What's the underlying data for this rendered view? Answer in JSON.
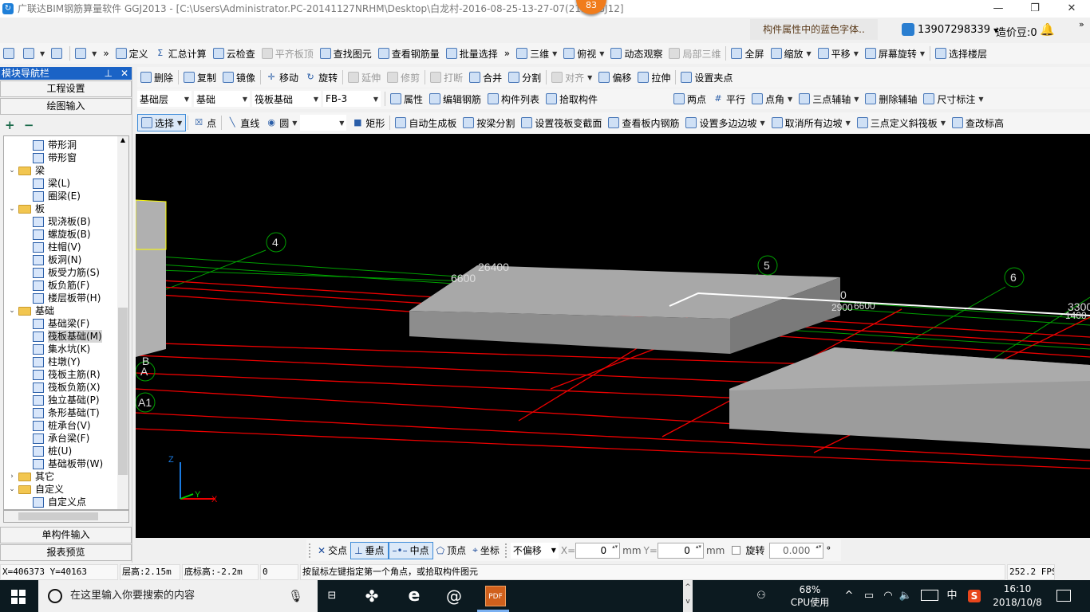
{
  "window": {
    "title": "广联达BIM钢筋算量软件 GGJ2013 - [C:\\Users\\Administrator.PC-20141127NRHM\\Desktop\\白龙村-2016-08-25-13-27-07(21...GGJ12]",
    "app_icon": "glodon-logo",
    "notification_badge": "83",
    "minimize": "—",
    "maximize": "❐",
    "close": "✕"
  },
  "topinfo": {
    "hint": "构件属性中的蓝色字体..",
    "user": "13907298339",
    "beans": "造价豆:0",
    "more": "»"
  },
  "toolbar1": [
    {
      "icon": "new-file-icon",
      "label": ""
    },
    {
      "icon": "open-folder-icon",
      "label": "",
      "dd": true
    },
    {
      "icon": "save-icon",
      "label": ""
    },
    {
      "sep": true
    },
    {
      "icon": "undo-icon",
      "label": "",
      "dd": true
    },
    {
      "icon": "more-icon",
      "label": "»"
    },
    {
      "icon": "define-icon",
      "label": "定义"
    },
    {
      "icon": "sigma-icon",
      "label": "汇总计算",
      "glyph": "Σ"
    },
    {
      "icon": "cloud-check-icon",
      "label": "云检查"
    },
    {
      "icon": "align-top-icon",
      "label": "平齐板顶",
      "disabled": true
    },
    {
      "icon": "binoculars-icon",
      "label": "查找图元"
    },
    {
      "icon": "view-rebar-icon",
      "label": "查看钢筋量"
    },
    {
      "icon": "batch-select-icon",
      "label": "批量选择"
    },
    {
      "icon": "more-icon",
      "label": "»"
    },
    {
      "icon": "cube-3d-icon",
      "label": "三维",
      "dd": true
    },
    {
      "icon": "top-view-icon",
      "label": "俯视",
      "dd": true
    },
    {
      "icon": "orbit-icon",
      "label": "动态观察"
    },
    {
      "icon": "local-3d-icon",
      "label": "局部三维",
      "disabled": true
    },
    {
      "sep": true
    },
    {
      "icon": "fullscreen-icon",
      "label": "全屏"
    },
    {
      "icon": "zoom-icon",
      "label": "缩放",
      "dd": true
    },
    {
      "icon": "pan-hand-icon",
      "label": "平移",
      "dd": true
    },
    {
      "icon": "screen-rotate-icon",
      "label": "屏幕旋转",
      "dd": true
    },
    {
      "sep": true
    },
    {
      "icon": "select-floor-icon",
      "label": "选择楼层"
    }
  ],
  "toolbar2": [
    {
      "icon": "delete-brush-icon",
      "label": "删除"
    },
    {
      "sep": true
    },
    {
      "icon": "copy-icon",
      "label": "复制"
    },
    {
      "icon": "mirror-icon",
      "label": "镜像"
    },
    {
      "sep": true
    },
    {
      "icon": "move-icon",
      "label": "移动",
      "glyph": "✛"
    },
    {
      "icon": "rotate-icon",
      "label": "旋转",
      "glyph": "↻"
    },
    {
      "sep": true
    },
    {
      "icon": "extend-icon",
      "label": "延伸",
      "disabled": true
    },
    {
      "icon": "trim-icon",
      "label": "修剪",
      "disabled": true
    },
    {
      "sep": true
    },
    {
      "icon": "break-icon",
      "label": "打断",
      "disabled": true
    },
    {
      "icon": "merge-icon",
      "label": "合并"
    },
    {
      "icon": "split-icon",
      "label": "分割"
    },
    {
      "sep": true
    },
    {
      "icon": "align-icon",
      "label": "对齐",
      "disabled": true,
      "dd": true
    },
    {
      "icon": "offset-icon",
      "label": "偏移"
    },
    {
      "icon": "stretch-icon",
      "label": "拉伸"
    },
    {
      "sep": true
    },
    {
      "icon": "set-grip-icon",
      "label": "设置夹点"
    }
  ],
  "selectors": {
    "floor": "基础层",
    "category": "基础",
    "type": "筏板基础",
    "member": "FB-3"
  },
  "toolbar3": [
    {
      "icon": "properties-icon",
      "label": "属性"
    },
    {
      "icon": "edit-rebar-icon",
      "label": "编辑钢筋"
    },
    {
      "icon": "member-list-icon",
      "label": "构件列表"
    },
    {
      "icon": "pick-member-icon",
      "label": "拾取构件"
    }
  ],
  "toolbar3b": [
    {
      "icon": "two-point-axis-icon",
      "label": "两点"
    },
    {
      "icon": "parallel-axis-icon",
      "label": "平行",
      "glyph": "#"
    },
    {
      "icon": "point-angle-icon",
      "label": "点角",
      "dd": true
    },
    {
      "icon": "three-point-axis-icon",
      "label": "三点辅轴",
      "dd": true
    },
    {
      "icon": "delete-axis-icon",
      "label": "删除辅轴"
    },
    {
      "icon": "dimension-icon",
      "label": "尺寸标注",
      "dd": true
    }
  ],
  "toolbar4": [
    {
      "icon": "pointer-icon",
      "label": "选择",
      "dd": true,
      "selected": true
    },
    {
      "sep": true
    },
    {
      "icon": "point-icon",
      "label": "点",
      "glyph": "☒"
    },
    {
      "sep": true
    },
    {
      "icon": "line-icon",
      "label": "直线",
      "glyph": "╲"
    },
    {
      "icon": "circle-icon",
      "label": "圆",
      "dd": true,
      "glyph": "◉"
    },
    {
      "combo": true
    },
    {
      "icon": "rectangle-icon",
      "label": "矩形",
      "glyph": "■"
    },
    {
      "sep": true
    },
    {
      "icon": "auto-slab-icon",
      "label": "自动生成板"
    },
    {
      "icon": "split-by-beam-icon",
      "label": "按梁分割"
    },
    {
      "icon": "raft-section-icon",
      "label": "设置筏板变截面"
    },
    {
      "icon": "view-slab-rebar-icon",
      "label": "查看板内钢筋"
    },
    {
      "icon": "multi-slope-icon",
      "label": "设置多边边坡",
      "dd": true
    },
    {
      "icon": "cancel-slope-icon",
      "label": "取消所有边坡",
      "dd": true
    },
    {
      "icon": "three-point-slope-icon",
      "label": "三点定义斜筏板",
      "dd": true
    },
    {
      "icon": "edit-elevation-icon",
      "label": "查改标高"
    }
  ],
  "nav": {
    "title": "模块导航栏",
    "pin": "ꟻ",
    "close": "✕",
    "project_settings": "工程设置",
    "drawing_input": "绘图输入",
    "expand_all": "+",
    "collapse_all": "−",
    "single_input": "单构件输入",
    "report_preview": "报表预览",
    "tree": [
      {
        "level": 2,
        "label": "带形洞"
      },
      {
        "level": 2,
        "label": "带形窗"
      },
      {
        "level": 1,
        "label": "梁",
        "open": true
      },
      {
        "level": 2,
        "label": "梁(L)"
      },
      {
        "level": 2,
        "label": "圈梁(E)"
      },
      {
        "level": 1,
        "label": "板",
        "open": true
      },
      {
        "level": 2,
        "label": "现浇板(B)"
      },
      {
        "level": 2,
        "label": "螺旋板(B)"
      },
      {
        "level": 2,
        "label": "柱帽(V)"
      },
      {
        "level": 2,
        "label": "板洞(N)"
      },
      {
        "level": 2,
        "label": "板受力筋(S)"
      },
      {
        "level": 2,
        "label": "板负筋(F)"
      },
      {
        "level": 2,
        "label": "楼层板带(H)"
      },
      {
        "level": 1,
        "label": "基础",
        "open": true
      },
      {
        "level": 2,
        "label": "基础梁(F)"
      },
      {
        "level": 2,
        "label": "筏板基础(M)",
        "selected": true
      },
      {
        "level": 2,
        "label": "集水坑(K)"
      },
      {
        "level": 2,
        "label": "柱墩(Y)"
      },
      {
        "level": 2,
        "label": "筏板主筋(R)"
      },
      {
        "level": 2,
        "label": "筏板负筋(X)"
      },
      {
        "level": 2,
        "label": "独立基础(P)"
      },
      {
        "level": 2,
        "label": "条形基础(T)"
      },
      {
        "level": 2,
        "label": "桩承台(V)"
      },
      {
        "level": 2,
        "label": "承台梁(F)"
      },
      {
        "level": 2,
        "label": "桩(U)"
      },
      {
        "level": 2,
        "label": "基础板带(W)"
      },
      {
        "level": 1,
        "label": "其它",
        "open": false
      },
      {
        "level": 1,
        "label": "自定义",
        "open": true
      },
      {
        "level": 2,
        "label": "自定义点"
      }
    ]
  },
  "canvas": {
    "axis_labels": [
      "4",
      "5",
      "6",
      "B",
      "A",
      "A1"
    ],
    "dimensions": [
      "26400",
      "6600",
      "0",
      "2900",
      "6600",
      "3300",
      "1400"
    ],
    "ucs": {
      "z": "Z",
      "y": "Y",
      "x": "X"
    }
  },
  "snapbar": {
    "items": [
      {
        "icon": "intersection-icon",
        "label": "交点"
      },
      {
        "icon": "perpendicular-icon",
        "label": "垂点",
        "active": true
      },
      {
        "icon": "midpoint-icon",
        "label": "中点",
        "active": true
      },
      {
        "icon": "vertex-icon",
        "label": "顶点"
      },
      {
        "icon": "coordinate-icon",
        "label": "坐标"
      }
    ],
    "offset_mode": "不偏移",
    "x_label": "X=",
    "x_value": "0",
    "unit": "mm",
    "y_label": "Y=",
    "y_value": "0",
    "rotate_label": "旋转",
    "rotate_value": "0.000",
    "degree": "°"
  },
  "status": {
    "coords": "X=406373 Y=40163",
    "floor_height": "层高:2.15m",
    "bottom_elevation": "底标高:-2.2m",
    "value": "0",
    "prompt": "按鼠标左键指定第一个角点，或拾取构件图元",
    "fps": "252.2 FPS"
  },
  "taskbar": {
    "search_placeholder": "在这里输入你要搜索的内容",
    "cpu_percent": "68%",
    "cpu_label": "CPU使用",
    "ime": "中",
    "time": "16:10",
    "date": "2018/10/8"
  }
}
